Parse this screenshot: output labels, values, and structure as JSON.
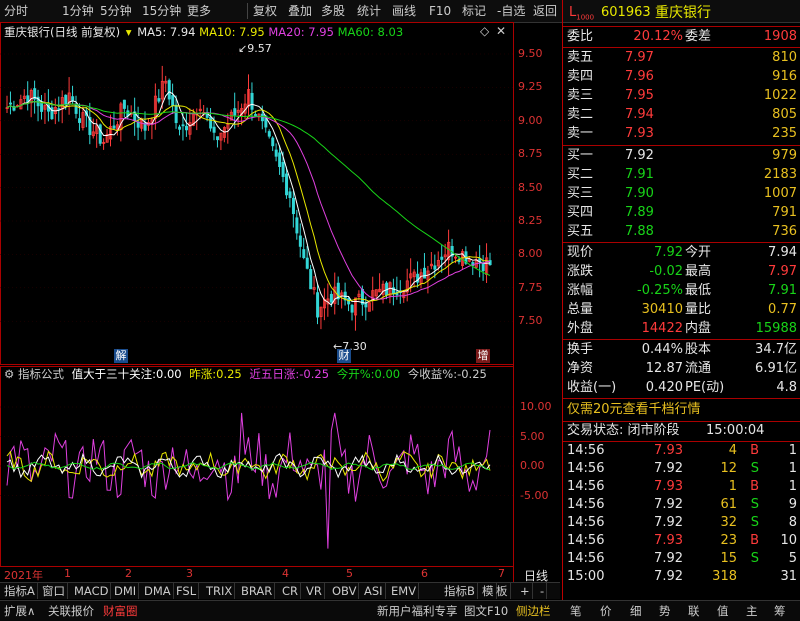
{
  "toolbar": {
    "items": [
      "分时",
      "1分钟",
      "5分钟",
      "15分钟",
      "更多",
      "复权",
      "叠加",
      "多股",
      "统计",
      "画线",
      "F10",
      "标记",
      "-自选",
      "返回"
    ]
  },
  "chart": {
    "stock_name": "重庆银行",
    "period_label": "(日线 前复权)",
    "ma5": "MA5: 7.94",
    "ma10": "MA10: 7.95",
    "ma20": "MA20: 7.95",
    "ma60": "MA60: 8.03",
    "price_axis": [
      "9.50",
      "9.25",
      "9.00",
      "8.75",
      "8.50",
      "8.25",
      "8.00",
      "7.75",
      "7.50"
    ],
    "high_mark": "9.57",
    "low_mark": "7.30",
    "events": [
      "解",
      "财",
      "增"
    ],
    "colors": {
      "ma5": "#ffffff",
      "ma10": "#e8e800",
      "ma20": "#e040e0",
      "ma60": "#18d418",
      "up": "#ff3b3b",
      "down": "#33d6d6"
    }
  },
  "indicator": {
    "name": "指标公式",
    "items": [
      {
        "label": "值大于三十关注:",
        "value": "0.00",
        "color": "#ffffff"
      },
      {
        "label": "昨涨:",
        "value": "0.25",
        "color": "#e8e800"
      },
      {
        "label": "近五日涨:",
        "value": "-0.25",
        "color": "#e040e0"
      },
      {
        "label": "今开%:",
        "value": "0.00",
        "color": "#18d418"
      },
      {
        "label": "今收益%:",
        "value": "-0.25",
        "color": "#cccccc"
      }
    ],
    "axis": [
      "10.00",
      "5.00",
      "0.00",
      "-5.00"
    ]
  },
  "time_axis": {
    "year": "2021年",
    "months": [
      "1",
      "2",
      "3",
      "4",
      "5",
      "6",
      "7"
    ],
    "right_label": "日线"
  },
  "tabs": [
    "指标A",
    "窗口",
    "MACD",
    "DMI",
    "DMA",
    "FSL",
    "TRIX",
    "BRAR",
    "CR",
    "VR",
    "OBV",
    "ASI",
    "EMV",
    "指标B",
    "模",
    "板",
    "+",
    "-"
  ],
  "status_bar": {
    "left": [
      "扩展∧",
      "关联报价",
      "财富圈"
    ],
    "middle": [
      "新用户福利专享",
      "图文F10",
      "侧边栏"
    ],
    "right_tabs": [
      "笔",
      "价",
      "细",
      "势",
      "联",
      "值",
      "主",
      "筹"
    ]
  },
  "quote": {
    "code": "601963",
    "name": "重庆银行",
    "weibi_label": "委比",
    "weibi": "20.12%",
    "weicha_label": "委差",
    "weicha": "1908",
    "sell": [
      {
        "label": "卖五",
        "price": "7.97",
        "vol": "810"
      },
      {
        "label": "卖四",
        "price": "7.96",
        "vol": "916"
      },
      {
        "label": "卖三",
        "price": "7.95",
        "vol": "1022"
      },
      {
        "label": "卖二",
        "price": "7.94",
        "vol": "805"
      },
      {
        "label": "卖一",
        "price": "7.93",
        "vol": "235"
      }
    ],
    "buy": [
      {
        "label": "买一",
        "price": "7.92",
        "vol": "979"
      },
      {
        "label": "买二",
        "price": "7.91",
        "vol": "2183"
      },
      {
        "label": "买三",
        "price": "7.90",
        "vol": "1007"
      },
      {
        "label": "买四",
        "price": "7.89",
        "vol": "791"
      },
      {
        "label": "买五",
        "price": "7.88",
        "vol": "736"
      }
    ],
    "stats": [
      {
        "l1": "现价",
        "v1": "7.92",
        "l2": "今开",
        "v2": "7.94"
      },
      {
        "l1": "涨跌",
        "v1": "-0.02",
        "l2": "最高",
        "v2": "7.97"
      },
      {
        "l1": "涨幅",
        "v1": "-0.25%",
        "l2": "最低",
        "v2": "7.91"
      },
      {
        "l1": "总量",
        "v1": "30410",
        "l2": "量比",
        "v2": "0.77"
      },
      {
        "l1": "外盘",
        "v1": "14422",
        "l2": "内盘",
        "v2": "15988"
      }
    ],
    "stats2": [
      {
        "l1": "换手",
        "v1": "0.44%",
        "l2": "股本",
        "v2": "34.7亿"
      },
      {
        "l1": "净资",
        "v1": "12.87",
        "l2": "流通",
        "v2": "6.91亿"
      },
      {
        "l1": "收益(一)",
        "v1": "0.420",
        "l2": "PE(动)",
        "v2": "4.8"
      }
    ],
    "promo": "仅需20元查看千档行情",
    "trade_status": "交易状态: 闭市阶段",
    "trade_time": "15:00:04",
    "ticks": [
      {
        "time": "14:56",
        "price": "7.93",
        "vol": "4",
        "side": "B",
        "n": "1"
      },
      {
        "time": "14:56",
        "price": "7.92",
        "vol": "12",
        "side": "S",
        "n": "1"
      },
      {
        "time": "14:56",
        "price": "7.93",
        "vol": "1",
        "side": "B",
        "n": "1"
      },
      {
        "time": "14:56",
        "price": "7.92",
        "vol": "61",
        "side": "S",
        "n": "9"
      },
      {
        "time": "14:56",
        "price": "7.92",
        "vol": "32",
        "side": "S",
        "n": "8"
      },
      {
        "time": "14:56",
        "price": "7.93",
        "vol": "23",
        "side": "B",
        "n": "10"
      },
      {
        "time": "14:56",
        "price": "7.92",
        "vol": "15",
        "side": "S",
        "n": "5"
      },
      {
        "time": "15:00",
        "price": "7.92",
        "vol": "318",
        "side": "",
        "n": "31"
      }
    ]
  }
}
